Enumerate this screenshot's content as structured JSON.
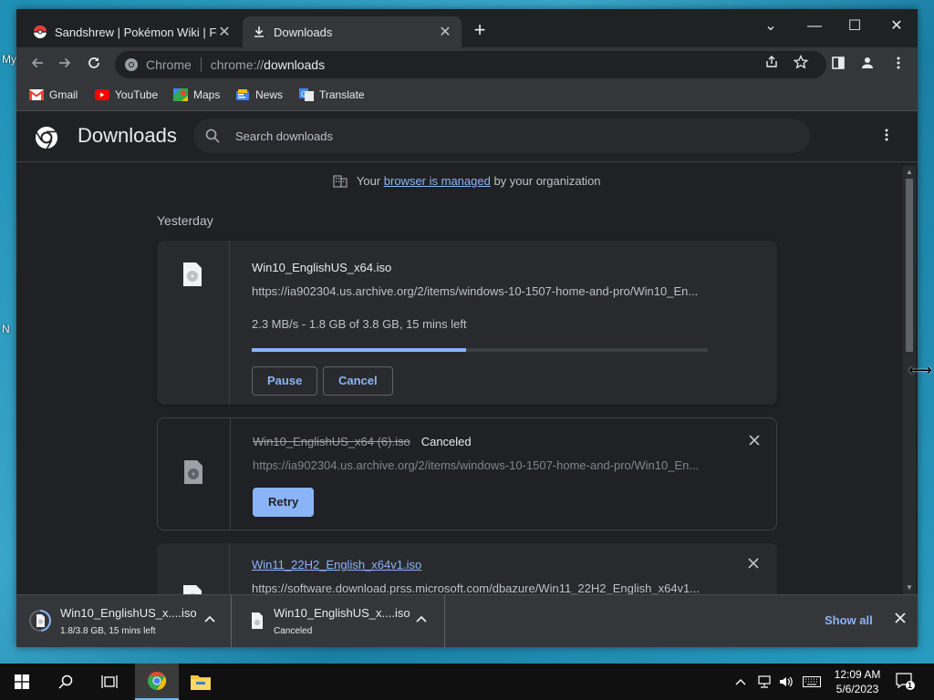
{
  "desktop": {
    "labels": [
      "My",
      "N"
    ]
  },
  "tabs": [
    {
      "title": "Sandshrew | Pokémon Wiki | Fandom",
      "close": "✕"
    },
    {
      "title": "Downloads",
      "close": "✕"
    }
  ],
  "new_tab": "+",
  "window_controls": {
    "tab_search": "⌄",
    "minimize": "—",
    "maximize": "☐",
    "close": "✕"
  },
  "omnibox": {
    "site_label": "Chrome",
    "scheme": "chrome://",
    "host": "downloads"
  },
  "bookmarks": [
    {
      "label": "Gmail",
      "icon": "gmail-icon",
      "color": "#ea4335"
    },
    {
      "label": "YouTube",
      "icon": "youtube-icon",
      "color": "#ff0000"
    },
    {
      "label": "Maps",
      "icon": "maps-icon",
      "color": "#34a853"
    },
    {
      "label": "News",
      "icon": "news-icon",
      "color": "#4285f4"
    },
    {
      "label": "Translate",
      "icon": "translate-icon",
      "color": "#4285f4"
    }
  ],
  "page": {
    "title": "Downloads",
    "search_placeholder": "Search downloads",
    "managed": {
      "before": "Your",
      "link": "browser is managed",
      "after": "by your organization"
    },
    "day_label": "Yesterday"
  },
  "downloads": [
    {
      "name": "Win10_EnglishUS_x64.iso",
      "url": "https://ia902304.us.archive.org/2/items/windows-10-1507-home-and-pro/Win10_En...",
      "progress_text": "2.3 MB/s - 1.8 GB of 3.8 GB, 15 mins left",
      "progress_fraction": 0.47,
      "buttons": {
        "pause": "Pause",
        "cancel": "Cancel"
      }
    },
    {
      "name": "Win10_EnglishUS_x64 (6).iso",
      "status": "Canceled",
      "url": "https://ia902304.us.archive.org/2/items/windows-10-1507-home-and-pro/Win10_En...",
      "buttons": {
        "retry": "Retry"
      }
    },
    {
      "name": "Win11_22H2_English_x64v1.iso",
      "url": "https://software.download.prss.microsoft.com/dbazure/Win11_22H2_English_x64v1..."
    }
  ],
  "shelf": {
    "items": [
      {
        "name": "Win10_EnglishUS_x....iso",
        "sub": "1.8/3.8 GB, 15 mins left"
      },
      {
        "name": "Win10_EnglishUS_x....iso",
        "sub": "Canceled"
      }
    ],
    "show_all": "Show all"
  },
  "taskbar": {
    "clock_time": "12:09 AM",
    "clock_date": "5/6/2023",
    "notification_count": "1"
  },
  "colors": {
    "accent": "#8ab4f8",
    "background": "#202124",
    "card": "#292a2d"
  }
}
